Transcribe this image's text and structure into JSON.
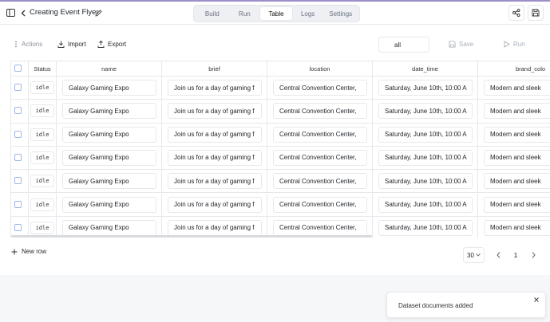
{
  "header": {
    "title": "Creating Event Flyer",
    "tabs": [
      {
        "label": "Build"
      },
      {
        "label": "Run"
      },
      {
        "label": "Table",
        "active": true
      },
      {
        "label": "Logs"
      },
      {
        "label": "Settings"
      }
    ],
    "icons": [
      "sidebar-toggle-icon",
      "back-arrow-icon",
      "pencil-icon",
      "share-icon",
      "save-icon"
    ]
  },
  "toolbar": {
    "actions_label": "Actions",
    "import_label": "Import",
    "export_label": "Export",
    "filter_value": "all",
    "save_label": "Save",
    "run_label": "Run"
  },
  "table": {
    "columns": [
      "Status",
      "name",
      "brief",
      "location",
      "date_time",
      "brand_colo"
    ],
    "rows": [
      {
        "status": "idle",
        "name": "Galaxy Gaming Expo",
        "brief": "Join us for a day of gaming f",
        "location": "Central Convention Center,",
        "date_time": "Saturday, June 10th, 10:00 A",
        "brand_colo": "Modern and sleek"
      },
      {
        "status": "idle",
        "name": "Galaxy Gaming Expo",
        "brief": "Join us for a day of gaming f",
        "location": "Central Convention Center,",
        "date_time": "Saturday, June 10th, 10:00 A",
        "brand_colo": "Modern and sleek"
      },
      {
        "status": "idle",
        "name": "Galaxy Gaming Expo",
        "brief": "Join us for a day of gaming f",
        "location": "Central Convention Center,",
        "date_time": "Saturday, June 10th, 10:00 A",
        "brand_colo": "Modern and sleek"
      },
      {
        "status": "idle",
        "name": "Galaxy Gaming Expo",
        "brief": "Join us for a day of gaming f",
        "location": "Central Convention Center,",
        "date_time": "Saturday, June 10th, 10:00 A",
        "brand_colo": "Modern and sleek"
      },
      {
        "status": "idle",
        "name": "Galaxy Gaming Expo",
        "brief": "Join us for a day of gaming f",
        "location": "Central Convention Center,",
        "date_time": "Saturday, June 10th, 10:00 A",
        "brand_colo": "Modern and sleek"
      },
      {
        "status": "idle",
        "name": "Galaxy Gaming Expo",
        "brief": "Join us for a day of gaming f",
        "location": "Central Convention Center,",
        "date_time": "Saturday, June 10th, 10:00 A",
        "brand_colo": "Modern and sleek"
      },
      {
        "status": "idle",
        "name": "Galaxy Gaming Expo",
        "brief": "Join us for a day of gaming f",
        "location": "Central Convention Center,",
        "date_time": "Saturday, June 10th, 10:00 A",
        "brand_colo": "Modern and sleek"
      }
    ]
  },
  "footer": {
    "new_row_label": "New row",
    "page_size": "30",
    "page_number": "1"
  },
  "toast": {
    "message": "Dataset documents added"
  },
  "colors": {
    "accent_line": "#9b8ec9",
    "checkbox_border": "#9fb6e8"
  }
}
